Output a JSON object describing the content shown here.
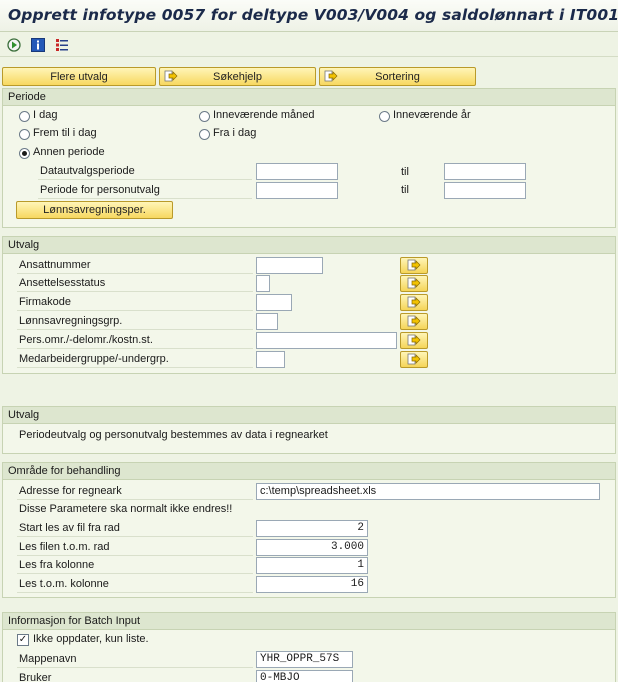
{
  "title": "Opprett infotype 0057 for deltype V003/V004 og saldolønnart i IT0015",
  "toolbar": {
    "icons": [
      "execute-icon",
      "info-icon",
      "variant-icon"
    ]
  },
  "buttons": {
    "more_selections": "Flere utvalg",
    "search_help": "Søkehjelp",
    "sorting": "Sortering"
  },
  "periode": {
    "header": "Periode",
    "radio_today": "I dag",
    "radio_current_month": "Inneværende måned",
    "radio_current_year": "Inneværende år",
    "radio_up_to_today": "Frem til i dag",
    "radio_from_today": "Fra i dag",
    "radio_other": "Annen periode",
    "selected": "radio_other",
    "data_period_label": "Datautvalgsperiode",
    "person_period_label": "Periode for personutvalg",
    "to_label": "til",
    "payroll_button": "Lønnsavregningsper."
  },
  "utvalg": {
    "header": "Utvalg",
    "fields": [
      "Ansattnummer",
      "Ansettelsesstatus",
      "Firmakode",
      "Lønnsavregningsgrp.",
      "Pers.omr./-delomr./kostn.st.",
      "Medarbeidergruppe/-undergrp."
    ]
  },
  "utvalg_info": {
    "header": "Utvalg",
    "text": "Periodeutvalg og personutvalg bestemmes av data i regnearket"
  },
  "omrade": {
    "header": "Område for behandling",
    "address_label": "Adresse for regneark",
    "address_value": "c:\\temp\\spreadsheet.xls",
    "note": "Disse Parametere ska normalt ikke endres!!",
    "start_row_label": "Start les av fil fra rad",
    "start_row_value": "2",
    "end_row_label": "Les filen t.o.m. rad",
    "end_row_value": "3.000",
    "from_col_label": "Les fra kolonne",
    "from_col_value": "1",
    "to_col_label": "Les t.o.m. kolonne",
    "to_col_value": "16"
  },
  "batch": {
    "header": "Informasjon for Batch Input",
    "checkbox_label": "Ikke oppdater, kun liste.",
    "checked": true,
    "folder_label": "Mappenavn",
    "folder_value": "YHR_OPPR_57S",
    "user_label": "Bruker",
    "user_value": "0-MBJO"
  }
}
